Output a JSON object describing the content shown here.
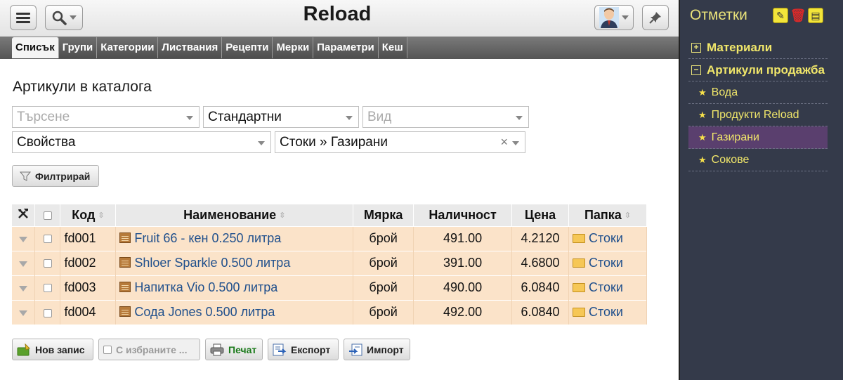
{
  "app": {
    "title": "Reload"
  },
  "tabs": [
    "Списък",
    "Групи",
    "Категории",
    "Листвания",
    "Рецепти",
    "Мерки",
    "Параметри",
    "Кеш"
  ],
  "page": {
    "title": "Артикули в каталога"
  },
  "filters": {
    "search_placeholder": "Търсене",
    "view": "Стандартни",
    "type_placeholder": "Вид",
    "properties": "Свойства",
    "folder": "Стоки » Газирани",
    "filter_button": "Филтрирай"
  },
  "table": {
    "headers": [
      "Код",
      "Наименование",
      "Мярка",
      "Наличност",
      "Цена",
      "Папка"
    ],
    "rows": [
      {
        "code": "fd001",
        "name": "Fruit 66 - кен 0.250 литра",
        "unit": "брой",
        "qty": "491.00",
        "price": "4.2120",
        "folder": "Стоки"
      },
      {
        "code": "fd002",
        "name": "Shloer Sparkle 0.500 литра",
        "unit": "брой",
        "qty": "391.00",
        "price": "4.6800",
        "folder": "Стоки"
      },
      {
        "code": "fd003",
        "name": "Напитка Vio 0.500 литра",
        "unit": "брой",
        "qty": "490.00",
        "price": "6.0840",
        "folder": "Стоки"
      },
      {
        "code": "fd004",
        "name": "Сода Jones 0.500 литра",
        "unit": "брой",
        "qty": "492.00",
        "price": "6.0840",
        "folder": "Стоки"
      }
    ]
  },
  "actions": {
    "new_record": "Нов запис",
    "with_selected": "С избраните ...",
    "print": "Печат",
    "export": "Експорт",
    "import": "Импорт"
  },
  "sidebar": {
    "title": "Отметки",
    "groups": [
      {
        "label": "Материали",
        "expanded": false
      },
      {
        "label": "Артикули продажба",
        "expanded": true
      }
    ],
    "items": [
      "Вода",
      "Продукти Reload",
      "Газирани",
      "Сокове"
    ],
    "active_item": "Газирани"
  }
}
